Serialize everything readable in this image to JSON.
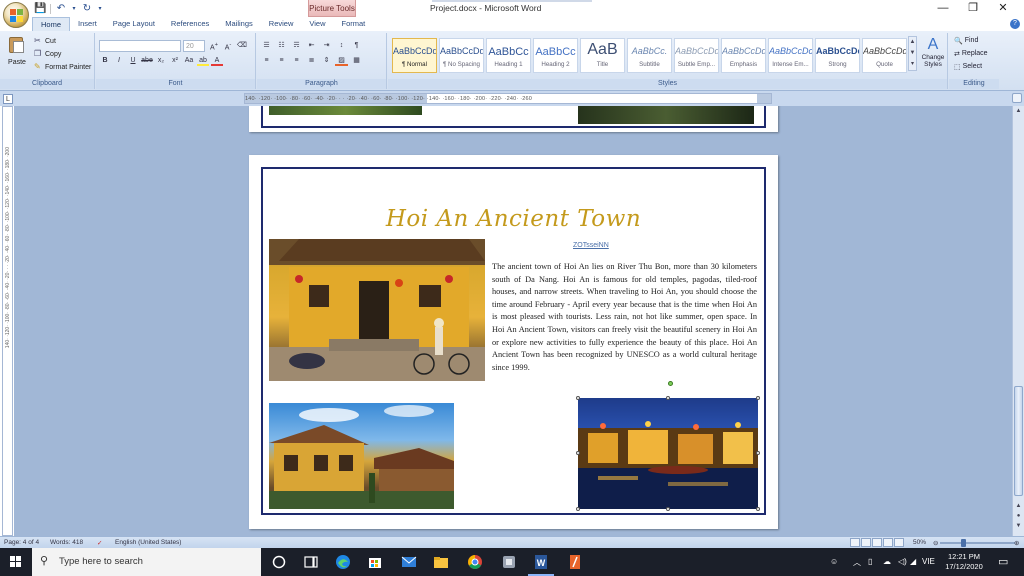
{
  "window": {
    "document_title": "Project.docx - Microsoft Word",
    "contextual_tab": "Picture Tools",
    "controls": {
      "minimize": "—",
      "restore": "❐",
      "close": "✕"
    }
  },
  "ribbon": {
    "tabs": [
      "Home",
      "Insert",
      "Page Layout",
      "References",
      "Mailings",
      "Review",
      "View",
      "Format"
    ],
    "active_tab": "Home",
    "clipboard": {
      "paste": "Paste",
      "cut": "Cut",
      "copy": "Copy",
      "format_painter": "Format Painter",
      "label": "Clipboard"
    },
    "font": {
      "font_name": "",
      "font_size": "20",
      "label": "Font"
    },
    "paragraph": {
      "label": "Paragraph"
    },
    "styles": {
      "label": "Styles",
      "items": [
        {
          "sample": "AaBbCcDd",
          "name": "¶ Normal"
        },
        {
          "sample": "AaBbCcDd",
          "name": "¶ No Spacing"
        },
        {
          "sample": "AaBbCc",
          "name": "Heading 1"
        },
        {
          "sample": "AaBbCc",
          "name": "Heading 2"
        },
        {
          "sample": "AaB",
          "name": "Title"
        },
        {
          "sample": "AaBbCc.",
          "name": "Subtitle"
        },
        {
          "sample": "AaBbCcDd",
          "name": "Subtle Emp..."
        },
        {
          "sample": "AaBbCcDd",
          "name": "Emphasis"
        },
        {
          "sample": "AaBbCcDc",
          "name": "Intense Em..."
        },
        {
          "sample": "AaBbCcDc",
          "name": "Strong"
        },
        {
          "sample": "AaBbCcDd",
          "name": "Quote"
        }
      ],
      "change_styles": "Change Styles"
    },
    "editing": {
      "find": "Find",
      "replace": "Replace",
      "select": "Select",
      "label": "Editing"
    }
  },
  "ruler": {
    "corner": "L",
    "horizontal_text": "140· ·120· ·100· ·80· ·60· ·40· ·20· · · ·20· ·40· ·60· ·80· ·100· ·120· ·140· ·160· ·180· ·200· ·220· ·240· ·260",
    "vertical_text": "140· ·120· ·100· ·80· ·60· ·40· ·20· · · ·20· ·40· ·60· ·80· ·100· ·120· ·140· ·160· ·180· ·200"
  },
  "document": {
    "title": "Hoi An Ancient Town",
    "credit": "ZOTsseiNN",
    "body": "The ancient town of Hoi An lies on River Thu Bon, more than 30 kilometers south of Da Nang. Hoi An is famous for old  temples, pagodas, tiled-roof houses, and narrow streets. When traveling to Hoi An, you should choose the time around February - April every year because that is the time when Hoi An is most pleased with tourists. Less rain, not hot like summer, open space.  In Hoi An Ancient Town, visitors can freely visit the beautiful scenery in Hoi An or explore new activities to fully experience the beauty of this place. Hoi An Ancient Town has been recognized by UNESCO as a world cultural heritage since 1999."
  },
  "status": {
    "page": "Page: 4 of 4",
    "words": "Words: 418",
    "language": "English (United States)",
    "zoom": "50%"
  },
  "taskbar": {
    "search_placeholder": "Type here to search",
    "language": "VIE",
    "time": "12:21 PM",
    "date": "17/12/2020"
  },
  "colors": {
    "title_gold": "#c49a1c",
    "page_border": "#1e2a6e",
    "ribbon_bg": "#d3e0f1",
    "taskbar": "#1b1f29"
  }
}
